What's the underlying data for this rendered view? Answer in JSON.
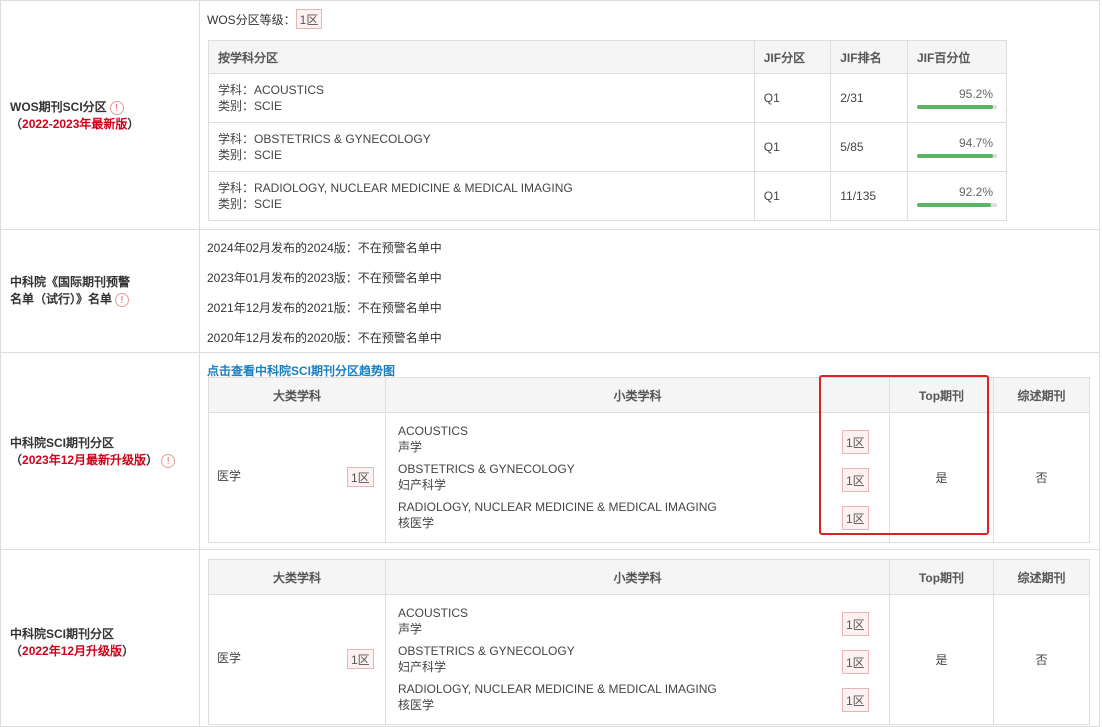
{
  "wos": {
    "label": "WOS期刊SCI分区",
    "label_sub": "2022-2023年最新版",
    "level_label": "WOS分区等级：",
    "level_value": "1区",
    "headers": [
      "按学科分区",
      "JIF分区",
      "JIF排名",
      "JIF百分位"
    ],
    "rows": [
      {
        "subject": "学科：ACOUSTICS",
        "category": "类别：SCIE",
        "quartile": "Q1",
        "rank": "2/31",
        "percentile": "95.2%",
        "pct_value": 95.2
      },
      {
        "subject": "学科：OBSTETRICS & GYNECOLOGY",
        "category": "类别：SCIE",
        "quartile": "Q1",
        "rank": "5/85",
        "percentile": "94.7%",
        "pct_value": 94.7
      },
      {
        "subject": "学科：RADIOLOGY, NUCLEAR MEDICINE & MEDICAL IMAGING",
        "category": "类别：SCIE",
        "quartile": "Q1",
        "rank": "11/135",
        "percentile": "92.2%",
        "pct_value": 92.2
      }
    ]
  },
  "warning": {
    "label_line1": "中科院《国际期刊预警",
    "label_line2": "名单（试行）》名单",
    "items": [
      "2024年02月发布的2024版：不在预警名单中",
      "2023年01月发布的2023版：不在预警名单中",
      "2021年12月发布的2021版：不在预警名单中",
      "2020年12月发布的2020版：不在预警名单中"
    ]
  },
  "cas2023": {
    "label": "中科院SCI期刊分区",
    "label_sub": "2023年12月最新升级版",
    "trend_link": "点击查看中科院SCI期刊分区趋势图",
    "headers": {
      "major": "大类学科",
      "minor": "小类学科",
      "top": "Top期刊",
      "review": "综述期刊"
    },
    "major_subject": "医学",
    "major_zone": "1区",
    "minor": [
      {
        "en": "ACOUSTICS",
        "zh": "声学",
        "zone": "1区"
      },
      {
        "en": "OBSTETRICS & GYNECOLOGY",
        "zh": "妇产科学",
        "zone": "1区"
      },
      {
        "en": "RADIOLOGY, NUCLEAR MEDICINE & MEDICAL IMAGING",
        "zh": "核医学",
        "zone": "1区"
      }
    ],
    "top": "是",
    "review": "否"
  },
  "cas2022": {
    "label": "中科院SCI期刊分区",
    "label_sub": "2022年12月升级版",
    "headers": {
      "major": "大类学科",
      "minor": "小类学科",
      "top": "Top期刊",
      "review": "综述期刊"
    },
    "major_subject": "医学",
    "major_zone": "1区",
    "minor": [
      {
        "en": "ACOUSTICS",
        "zh": "声学",
        "zone": "1区"
      },
      {
        "en": "OBSTETRICS & GYNECOLOGY",
        "zh": "妇产科学",
        "zone": "1区"
      },
      {
        "en": "RADIOLOGY, NUCLEAR MEDICINE & MEDICAL IMAGING",
        "zh": "核医学",
        "zone": "1区"
      }
    ],
    "top": "是",
    "review": "否"
  },
  "paren_open": "（",
  "paren_close": "）",
  "info_glyph": "!",
  "colors": {
    "accent_red": "#d0021b",
    "link_blue": "#1a7fc1",
    "bar_green": "#5ab565",
    "highlight_box": "#e02020"
  }
}
